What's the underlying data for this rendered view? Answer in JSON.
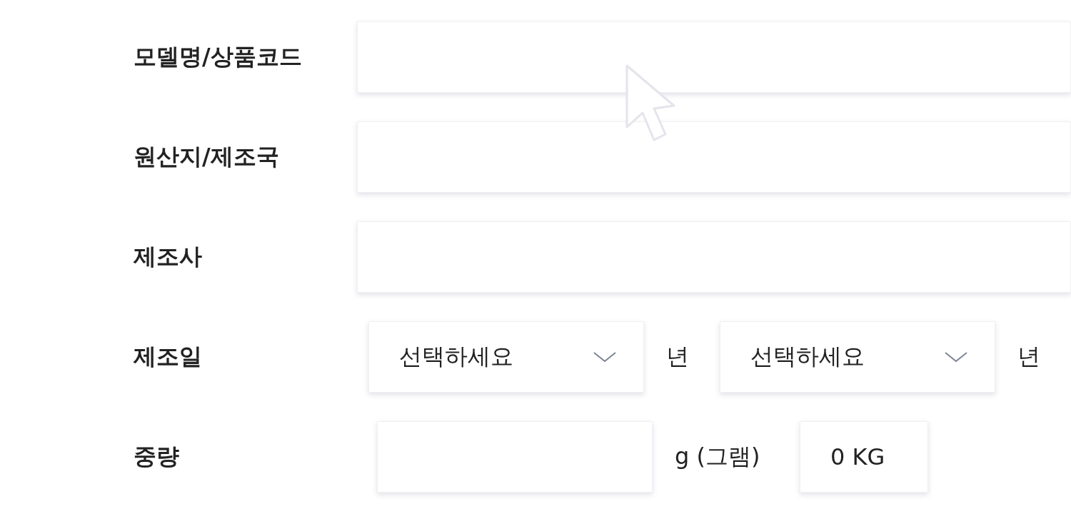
{
  "fields": [
    {
      "label": "모델명/상품코드",
      "kind": "text"
    },
    {
      "label": "원산지/제조국",
      "kind": "text"
    },
    {
      "label": "제조사",
      "kind": "text"
    },
    {
      "label": "제조일",
      "kind": "date",
      "selects": [
        {
          "placeholder": "선택하세요",
          "unit": "년"
        },
        {
          "placeholder": "선택하세요",
          "unit": "년"
        }
      ]
    },
    {
      "label": "중량",
      "kind": "weight",
      "unit": "g (그램)",
      "converted": "0 KG"
    }
  ]
}
